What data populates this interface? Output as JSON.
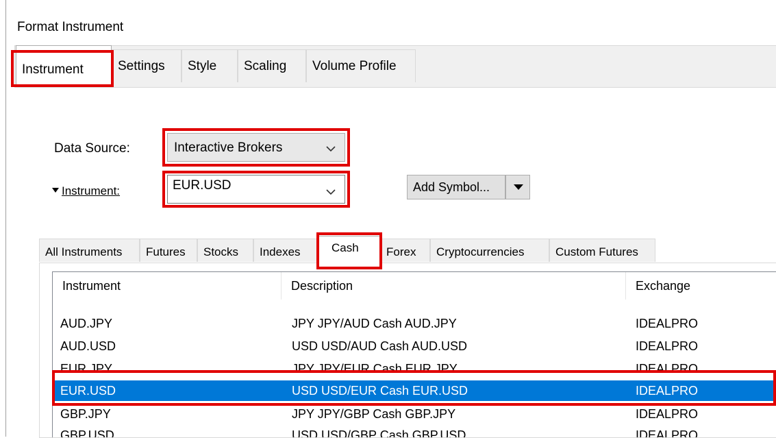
{
  "window": {
    "title": "Format Instrument"
  },
  "main_tabs": [
    {
      "label": "Instrument",
      "active": true
    },
    {
      "label": "Settings",
      "active": false
    },
    {
      "label": "Style",
      "active": false
    },
    {
      "label": "Scaling",
      "active": false
    },
    {
      "label": "Volume Profile",
      "active": false
    }
  ],
  "data_source": {
    "label": "Data Source:",
    "value": "Interactive Brokers"
  },
  "instrument": {
    "label": "Instrument:",
    "value": "EUR.USD"
  },
  "add_symbol_label": "Add Symbol...",
  "category_tabs": [
    {
      "label": "All Instruments",
      "active": false
    },
    {
      "label": "Futures",
      "active": false
    },
    {
      "label": "Stocks",
      "active": false
    },
    {
      "label": "Indexes",
      "active": false
    },
    {
      "label": "Cash",
      "active": true
    },
    {
      "label": "Forex",
      "active": false
    },
    {
      "label": "Cryptocurrencies",
      "active": false
    },
    {
      "label": "Custom Futures",
      "active": false
    }
  ],
  "table": {
    "columns": [
      "Instrument",
      "Description",
      "Exchange"
    ],
    "rows": [
      {
        "instrument": "AUD.JPY",
        "description": "JPY JPY/AUD Cash AUD.JPY",
        "exchange": "IDEALPRO",
        "selected": false
      },
      {
        "instrument": "AUD.USD",
        "description": "USD USD/AUD Cash AUD.USD",
        "exchange": "IDEALPRO",
        "selected": false
      },
      {
        "instrument": "EUR.JPY",
        "description": "JPY JPY/EUR Cash EUR.JPY",
        "exchange": "IDEALPRO",
        "selected": false
      },
      {
        "instrument": "EUR.USD",
        "description": "USD USD/EUR Cash EUR.USD",
        "exchange": "IDEALPRO",
        "selected": true
      },
      {
        "instrument": "GBP.JPY",
        "description": "JPY JPY/GBP Cash GBP.JPY",
        "exchange": "IDEALPRO",
        "selected": false
      },
      {
        "instrument": "GBP.USD",
        "description": "USD USD/GBP Cash GBP.USD",
        "exchange": "IDEALPRO",
        "selected": false
      }
    ]
  },
  "colors": {
    "highlight": "#e00000",
    "selection": "#0078d7"
  },
  "icons": {
    "combo_arrow": "chevron-down-icon",
    "split_arrow": "triangle-down-icon",
    "expander": "triangle-down-icon"
  }
}
